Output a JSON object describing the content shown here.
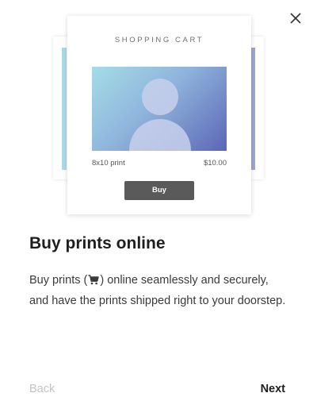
{
  "dialog": {
    "close_icon": "close-icon"
  },
  "illustration": {
    "cart_title": "SHOPPING CART",
    "photo_icon": "person-silhouette",
    "print_size": "8x10 print",
    "price": "$10.00",
    "buy_label": "Buy",
    "colors": {
      "photo_gradient_start": "#a4dde6",
      "photo_gradient_end": "#5a66b6",
      "buy_button": "#5a5a5a"
    }
  },
  "content": {
    "heading": "Buy prints online",
    "description_before_icon": "Buy prints (",
    "description_icon": "cart-icon",
    "description_after_icon": ") online seamlessly and securely, and have the prints shipped right to your doorstep."
  },
  "footer": {
    "back_label": "Back",
    "next_label": "Next",
    "back_enabled": false
  }
}
